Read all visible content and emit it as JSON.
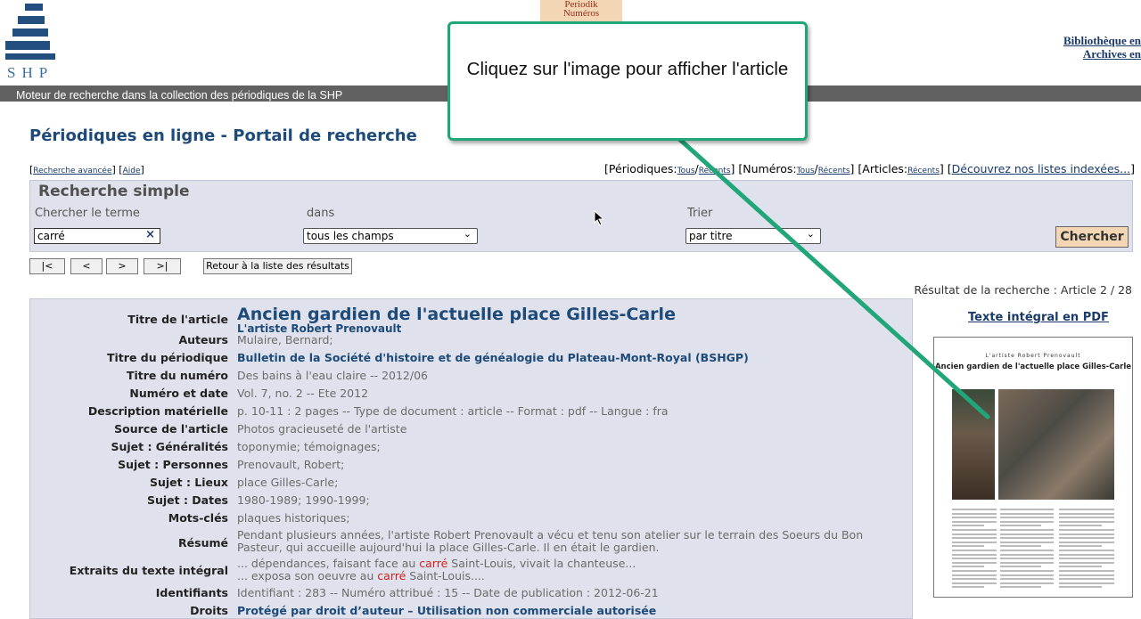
{
  "header": {
    "logo_text": "SHP",
    "periodik": [
      "Periodik",
      "Numéros"
    ],
    "right_links": [
      "Bibliothèque en ligne",
      "Archives en ligne"
    ],
    "bar_text": "Moteur de recherche dans la collection des périodiques de la SHP"
  },
  "page_title": "Périodiques en ligne - Portail de recherche",
  "links_left": {
    "advanced": "Recherche avancée",
    "help": "Aide"
  },
  "links_right": {
    "periodiques": "Périodiques:",
    "tous": "Tous",
    "recents": "Récents",
    "numeros": "Numéros:",
    "articles": "Articles:",
    "discover": "Découvrez nos listes indexées..."
  },
  "search": {
    "title": "Recherche simple",
    "label_term": "Chercher le terme",
    "label_in": "dans",
    "label_sort": "Trier",
    "term_value": "carré",
    "in_value": "tous les champs",
    "sort_value": "par titre",
    "submit": "Chercher"
  },
  "nav": {
    "first": "|<",
    "prev": "<",
    "next": ">",
    "last": ">|",
    "back": "Retour à la liste des résultats"
  },
  "result_count": "Résultat de la recherche : Article   2 / 28",
  "article": {
    "title": "Ancien gardien de l'actuelle place Gilles-Carle",
    "subtitle": "L'artiste Robert Prenovault",
    "fields": [
      {
        "k": "Auteurs",
        "v": "Mulaire, Bernard;"
      },
      {
        "k": "Titre du périodique",
        "v": "Bulletin de la Société d'histoire et de généalogie du Plateau-Mont-Royal (BSHGP)"
      },
      {
        "k": "Titre du numéro",
        "v": "Des bains à l'eau claire -- 2012/06"
      },
      {
        "k": "Numéro et date",
        "v": "Vol. 7, no. 2 -- Ete 2012"
      },
      {
        "k": "Description matérielle",
        "v": "p. 10-11 : 2 pages -- Type de document : article -- Format : pdf -- Langue : fra"
      },
      {
        "k": "Source de l'article",
        "v": "Photos gracieuseté de l'artiste"
      },
      {
        "k": "Sujet : Généralités",
        "v": "toponymie; témoignages;"
      },
      {
        "k": "Sujet : Personnes",
        "v": "Prenovault, Robert;"
      },
      {
        "k": "Sujet : Lieux",
        "v": "place Gilles-Carle;"
      },
      {
        "k": "Sujet : Dates",
        "v": "1980-1989; 1990-1999;"
      },
      {
        "k": "Mots-clés",
        "v": "plaques historiques;"
      }
    ],
    "resume_label": "Résumé",
    "resume": "Pendant plusieurs années, l'artiste Robert Prenovault a vécu et tenu son atelier sur le terrain des Soeurs du Bon Pasteur, qui accueille aujourd'hui la place Gilles-Carle. Il en était le gardien.",
    "extracts_label": "Extraits du texte intégral",
    "extract1_a": "... dépendances, faisant face au ",
    "extract1_hl": "carré",
    "extract1_b": " Saint-Louis, vivait la chanteuse...",
    "extract2_a": "... exposa son oeuvre au ",
    "extract2_hl": "carré",
    "extract2_b": " Saint-Louis....",
    "ident_label": "Identifiants",
    "ident": "Identifiant : 283 -- Numéro attribué : 15 -- Date de publication : 2012-06-21",
    "rights_label": "Droits",
    "rights": "Protégé par droit d’auteur – Utilisation non commerciale autorisée"
  },
  "pdf": {
    "link": "Texte intégral en PDF",
    "thumb_kicker": "L'artiste Robert Prenovault",
    "thumb_title": "Ancien gardien de l'actuelle place Gilles-Carle"
  },
  "callout": "Cliquez sur l'image pour afficher l'article",
  "colors": {
    "accent": "#21a67a",
    "header_bar": "#616161",
    "panel": "#dfe2ec",
    "title_blue": "#1d4a78"
  }
}
